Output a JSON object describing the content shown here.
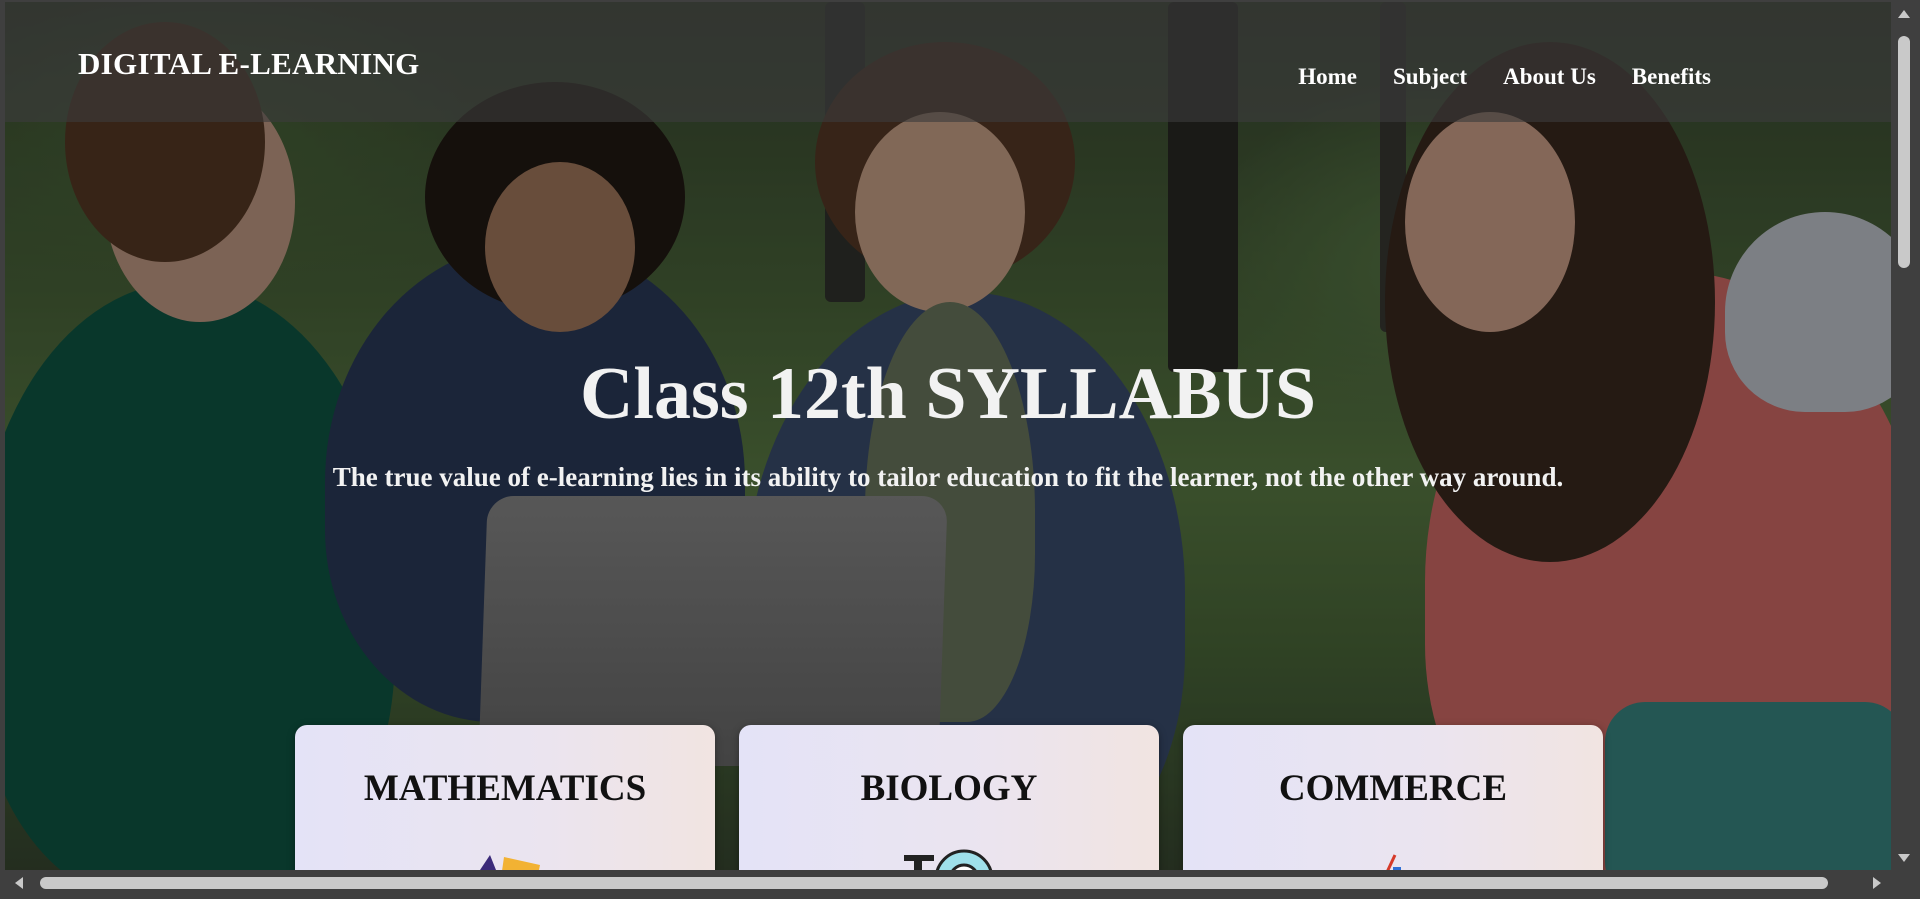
{
  "header": {
    "brand": "DIGITAL E-LEARNING",
    "nav": [
      "Home",
      "Subject",
      "About Us",
      "Benefits"
    ]
  },
  "hero": {
    "title": "Class 12th SYLLABUS",
    "quote": "The true value of e-learning lies in its ability to tailor education to fit the learner, not the other way around."
  },
  "cards": [
    {
      "title": "MATHEMATICS",
      "icon": "math-tools-icon"
    },
    {
      "title": "BIOLOGY",
      "icon": "microscope-icon"
    },
    {
      "title": "COMMERCE",
      "icon": "bar-chart-icon"
    }
  ],
  "colors": {
    "header_overlay": "#3c3c3c",
    "card_left": "#e4e3f7",
    "card_right": "#f1e4e1",
    "text_light": "#f2f2f2"
  }
}
